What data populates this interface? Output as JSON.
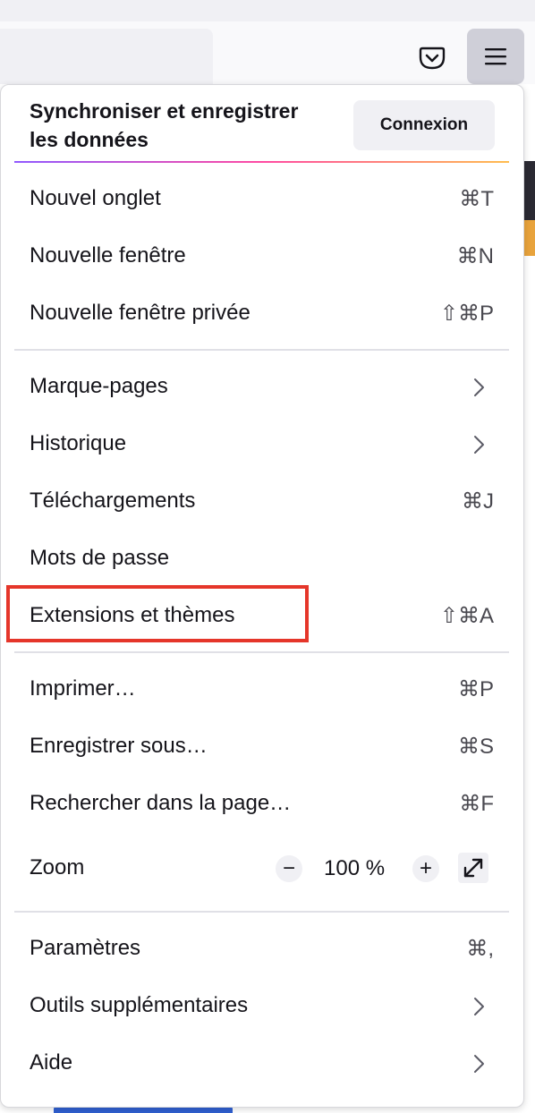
{
  "toolbar": {
    "pocket_icon": "pocket-icon",
    "menu_icon": "hamburger-icon"
  },
  "menu": {
    "sync": {
      "title": "Synchroniser et enregistrer les données",
      "login_label": "Connexion"
    },
    "group1": [
      {
        "label": "Nouvel onglet",
        "shortcut": "⌘T"
      },
      {
        "label": "Nouvelle fenêtre",
        "shortcut": "⌘N"
      },
      {
        "label": "Nouvelle fenêtre privée",
        "shortcut": "⇧⌘P"
      }
    ],
    "group2": [
      {
        "label": "Marque-pages",
        "submenu": true
      },
      {
        "label": "Historique",
        "submenu": true
      },
      {
        "label": "Téléchargements",
        "shortcut": "⌘J"
      },
      {
        "label": "Mots de passe",
        "shortcut": ""
      },
      {
        "label": "Extensions et thèmes",
        "shortcut": "⇧⌘A",
        "highlighted": true
      }
    ],
    "group3": [
      {
        "label": "Imprimer…",
        "shortcut": "⌘P"
      },
      {
        "label": "Enregistrer sous…",
        "shortcut": "⌘S"
      },
      {
        "label": "Rechercher dans la page…",
        "shortcut": "⌘F"
      }
    ],
    "zoom": {
      "label": "Zoom",
      "minus": "−",
      "plus": "+",
      "value": "100 %"
    },
    "group4": [
      {
        "label": "Paramètres",
        "shortcut": "⌘,"
      },
      {
        "label": "Outils supplémentaires",
        "submenu": true
      },
      {
        "label": "Aide",
        "submenu": true
      }
    ]
  },
  "colors": {
    "highlight_border": "#e5362a",
    "accent_gradient": [
      "#9059ff",
      "#ff4aa2",
      "#ffbd4f"
    ]
  }
}
